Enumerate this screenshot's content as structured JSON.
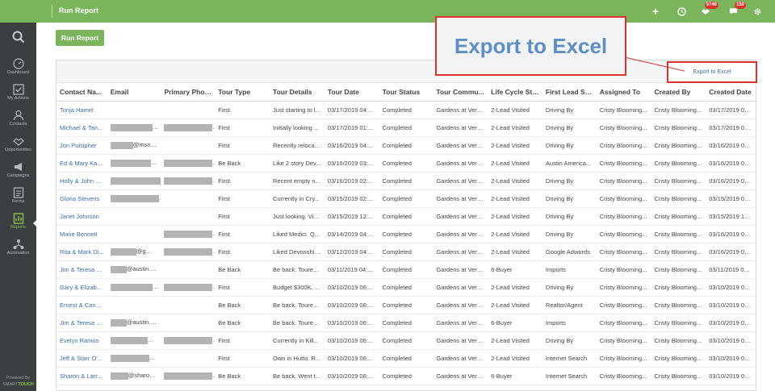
{
  "topbar": {
    "title": "Run Report",
    "badge_a": "5746",
    "badge_b": "150"
  },
  "sidebar": {
    "items": [
      {
        "label": "Dashboard",
        "icon": "dashboard-icon"
      },
      {
        "label": "My Actions",
        "icon": "checkbox-icon"
      },
      {
        "label": "Contacts",
        "icon": "contacts-icon"
      },
      {
        "label": "Opportunities",
        "icon": "handshake-icon"
      },
      {
        "label": "Campaigns",
        "icon": "megaphone-icon"
      },
      {
        "label": "Forms",
        "icon": "form-icon"
      },
      {
        "label": "Reports",
        "icon": "report-icon"
      },
      {
        "label": "Automation",
        "icon": "automation-icon"
      }
    ],
    "powered_by": "Powered By",
    "brand_a": "SMART",
    "brand_b": "TOUCH"
  },
  "main": {
    "run_report_label": "Run Report",
    "export_label": "Export to Excel",
    "callout_label": "Export to Excel"
  },
  "table": {
    "headers": [
      "Contact Na...",
      "Email",
      "Primary Phone",
      "Tour Type",
      "Tour Details",
      "Tour Date",
      "Tour Status",
      "Tour Commu...",
      "Life Cycle Sta...",
      "First Lead So...",
      "Assigned To",
      "Created By",
      "Created Date"
    ],
    "rows": [
      {
        "name": "Tonja Hamel",
        "email": "",
        "phone": "",
        "type": "First",
        "details": "Just starting to l...",
        "date": "03/17/2019 04:...",
        "status": "Completed",
        "community": "Gardens at Verd...",
        "lifecycle": "2-Lead Visited",
        "lead": "Driving By",
        "assigned": "Cristy Blooming...",
        "created_by": "Cristy Blooming...",
        "created": "03/17/2019 04:..."
      },
      {
        "name": "Michael & Tan...",
        "email": "@georg...",
        "phone": "",
        "type": "First",
        "details": "Initially looking ...",
        "date": "03/17/2019 01:...",
        "status": "Completed",
        "community": "Gardens at Verd...",
        "lifecycle": "2-Lead Visited",
        "lead": "Driving By",
        "assigned": "Cristy Blooming...",
        "created_by": "Cristy Blooming...",
        "created": "03/17/2019 01:..."
      },
      {
        "name": "Jon Pulsipher",
        "email": "@msn.com",
        "phone": "",
        "type": "First",
        "details": "Recently relocat...",
        "date": "03/16/2019 04:...",
        "status": "Completed",
        "community": "Gardens at Verd...",
        "lifecycle": "2-Lead Visited",
        "lead": "Driving By",
        "assigned": "Cristy Blooming...",
        "created_by": "Cristy Blooming...",
        "created": "03/16/2019 04:..."
      },
      {
        "name": "Ed & Mary Ka...",
        "email": "@...",
        "phone": "",
        "type": "Be Back",
        "details": "Like 2 story Dev...",
        "date": "03/16/2019 03:...",
        "status": "Completed",
        "community": "Gardens at Verd...",
        "lifecycle": "2-Lead Visited",
        "lead": "Austin America...",
        "assigned": "Cristy Blooming...",
        "created_by": "Cristy Blooming...",
        "created": "03/16/2019 03:..."
      },
      {
        "name": "Holly & John ...",
        "email": "",
        "phone": "",
        "type": "First",
        "details": "Recent empty n...",
        "date": "03/16/2019 02:...",
        "status": "Completed",
        "community": "Gardens at Verd...",
        "lifecycle": "2-Lead Visited",
        "lead": "Driving By",
        "assigned": "Cristy Blooming...",
        "created_by": "Cristy Blooming...",
        "created": "03/16/2019 02:..."
      },
      {
        "name": "Gloria Stevens",
        "email": "@...",
        "phone": "",
        "type": "First",
        "details": "Currently in Cry...",
        "date": "03/15/2019 02:...",
        "status": "Completed",
        "community": "Gardens at Verd...",
        "lifecycle": "2-Lead Visited",
        "lead": "Driving By",
        "assigned": "Cristy Blooming...",
        "created_by": "Cristy Blooming...",
        "created": "03/15/2019 02:..."
      },
      {
        "name": "Janet Johnson",
        "email": "",
        "phone": "",
        "type": "First",
        "details": "Just looking. Visi...",
        "date": "03/15/2019 12:...",
        "status": "Completed",
        "community": "Gardens at Verd...",
        "lifecycle": "2-Lead Visited",
        "lead": "Driving By",
        "assigned": "Cristy Blooming...",
        "created_by": "Cristy Blooming...",
        "created": "03/15/2019 12:..."
      },
      {
        "name": "Marie Bennett",
        "email": "",
        "phone": "",
        "type": "First",
        "details": "Liked Medici. Q...",
        "date": "03/14/2019 04:...",
        "status": "Completed",
        "community": "Gardens at Verd...",
        "lifecycle": "2-Lead Visited",
        "lead": "Driving By",
        "assigned": "Cristy Blooming...",
        "created_by": "Cristy Blooming...",
        "created": "03/16/2019 03:..."
      },
      {
        "name": "Rita & Mark Di...",
        "email": "@g...",
        "phone": "",
        "type": "First",
        "details": "Liked Devonshire...",
        "date": "03/12/2019 04:...",
        "status": "Completed",
        "community": "Gardens at Verd...",
        "lifecycle": "2-Lead Visited",
        "lead": "Google Adwords",
        "assigned": "Cristy Blooming...",
        "created_by": "Cristy Blooming...",
        "created": "03/16/2019 03:..."
      },
      {
        "name": "Jim & Teresa F...",
        "email": "@austin.rr....",
        "phone": "",
        "type": "Be Back",
        "details": "Be back. Toured...",
        "date": "03/11/2019 04:...",
        "status": "Completed",
        "community": "Gardens at Verd...",
        "lifecycle": "6-Buyer",
        "lead": "Imports",
        "assigned": "Cristy Blooming...",
        "created_by": "Cristy Blooming...",
        "created": "03/11/2019 04:..."
      },
      {
        "name": "Gary & Elizab...",
        "email": "@gmail....",
        "phone": "",
        "type": "First",
        "details": "Budget $300K, ...",
        "date": "03/10/2019 06:...",
        "status": "Completed",
        "community": "Gardens at Verd...",
        "lifecycle": "2-Lead Visited",
        "lead": "Driving By",
        "assigned": "Cristy Blooming...",
        "created_by": "Cristy Blooming...",
        "created": "03/10/2019 06:..."
      },
      {
        "name": "Ernest & Cand...",
        "email": "",
        "phone": "",
        "type": "Be Back",
        "details": "Be back. Toured...",
        "date": "03/10/2019 06:...",
        "status": "Completed",
        "community": "Gardens at Verd...",
        "lifecycle": "2-Lead Visited",
        "lead": "Realtor/Agent",
        "assigned": "Cristy Blooming...",
        "created_by": "Cristy Blooming...",
        "created": "03/10/2019 06:..."
      },
      {
        "name": "Jim & Teresa F...",
        "email": "@austin.rr....",
        "phone": "",
        "type": "Be Back",
        "details": "Be back. Toured...",
        "date": "03/10/2019 06:...",
        "status": "Completed",
        "community": "Gardens at Verd...",
        "lifecycle": "6-Buyer",
        "lead": "Imports",
        "assigned": "Cristy Blooming...",
        "created_by": "Cristy Blooming...",
        "created": "03/10/2019 06:..."
      },
      {
        "name": "Evelyn Ramos",
        "email": "@y...",
        "phone": "",
        "type": "First",
        "details": "Currently in Kill...",
        "date": "03/10/2019 06:...",
        "status": "Completed",
        "community": "Gardens at Verd...",
        "lifecycle": "2-Lead Visited",
        "lead": "Driving By",
        "assigned": "Cristy Blooming...",
        "created_by": "Cristy Blooming...",
        "created": "03/10/2019 06:..."
      },
      {
        "name": "Jeff & Starr O'...",
        "email": "@gm...",
        "phone": "",
        "type": "First",
        "details": "Own in Hutto. R...",
        "date": "03/10/2019 06:...",
        "status": "Completed",
        "community": "Gardens at Verd...",
        "lifecycle": "2-Lead Visited",
        "lead": "Internet Search",
        "assigned": "Cristy Blooming...",
        "created_by": "Cristy Blooming...",
        "created": "03/10/2019 06:..."
      },
      {
        "name": "Sharon & Larr...",
        "email": "@sharon....",
        "phone": "",
        "type": "Be Back",
        "details": "Be back. Went t...",
        "date": "03/10/2019 06:...",
        "status": "Completed",
        "community": "Gardens at Verd...",
        "lifecycle": "6-Buyer",
        "lead": "Internet Search",
        "assigned": "Cristy Blooming...",
        "created_by": "Cristy Blooming...",
        "created": "03/10/2019 06:..."
      }
    ]
  },
  "colors": {
    "accent": "#7ab55c",
    "sidebar": "#3a3f42",
    "link": "#3b6ea8",
    "highlight": "#d9332b"
  }
}
